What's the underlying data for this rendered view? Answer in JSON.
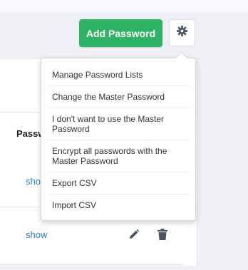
{
  "header": {
    "add_button_label": "Add Password",
    "settings_icon": "gear-icon"
  },
  "table": {
    "column_header": "Passw",
    "rows": [
      {
        "show_label": "sho"
      },
      {
        "show_label": "show"
      }
    ],
    "row_icons": [
      "pencil-icon",
      "trash-icon"
    ]
  },
  "dropdown": {
    "items": [
      "Manage Password Lists",
      "Change the Master Password",
      "I don't want to use the Master Password",
      "Encrypt all passwords with the Master Password",
      "Export CSV",
      "Import CSV"
    ]
  },
  "colors": {
    "accent_green": "#2fb366",
    "link_blue": "#2d7fc1",
    "icon_gray": "#4a5568"
  }
}
